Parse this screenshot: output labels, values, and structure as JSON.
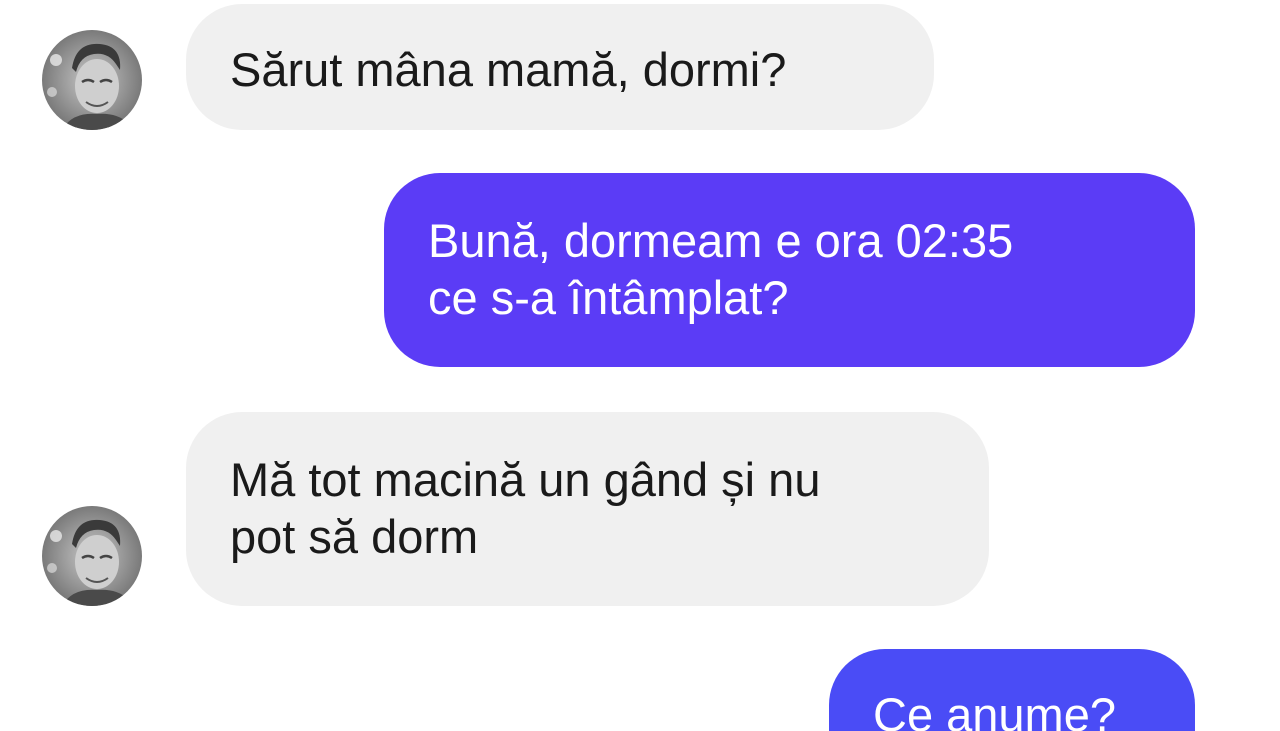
{
  "conversation": {
    "messages": [
      {
        "direction": "incoming",
        "lines": [
          "Sărut mâna mamă, dormi?"
        ],
        "avatar_icon": "contact-avatar"
      },
      {
        "direction": "outgoing",
        "lines": [
          "Bună, dormeam e ora 02:35",
          "ce s-a întâmplat?"
        ]
      },
      {
        "direction": "incoming",
        "lines": [
          "Mă tot macină un gând și nu",
          "pot să dorm"
        ],
        "avatar_icon": "contact-avatar"
      },
      {
        "direction": "outgoing",
        "lines": [
          "Ce anume?"
        ]
      }
    ]
  },
  "colors": {
    "incoming_bubble": "#f0f0f0",
    "outgoing_bubble_violet": "#5b3cf6",
    "outgoing_bubble_blue": "#4a4cf6",
    "text_dark": "#1a1a1a",
    "text_light": "#ffffff"
  }
}
